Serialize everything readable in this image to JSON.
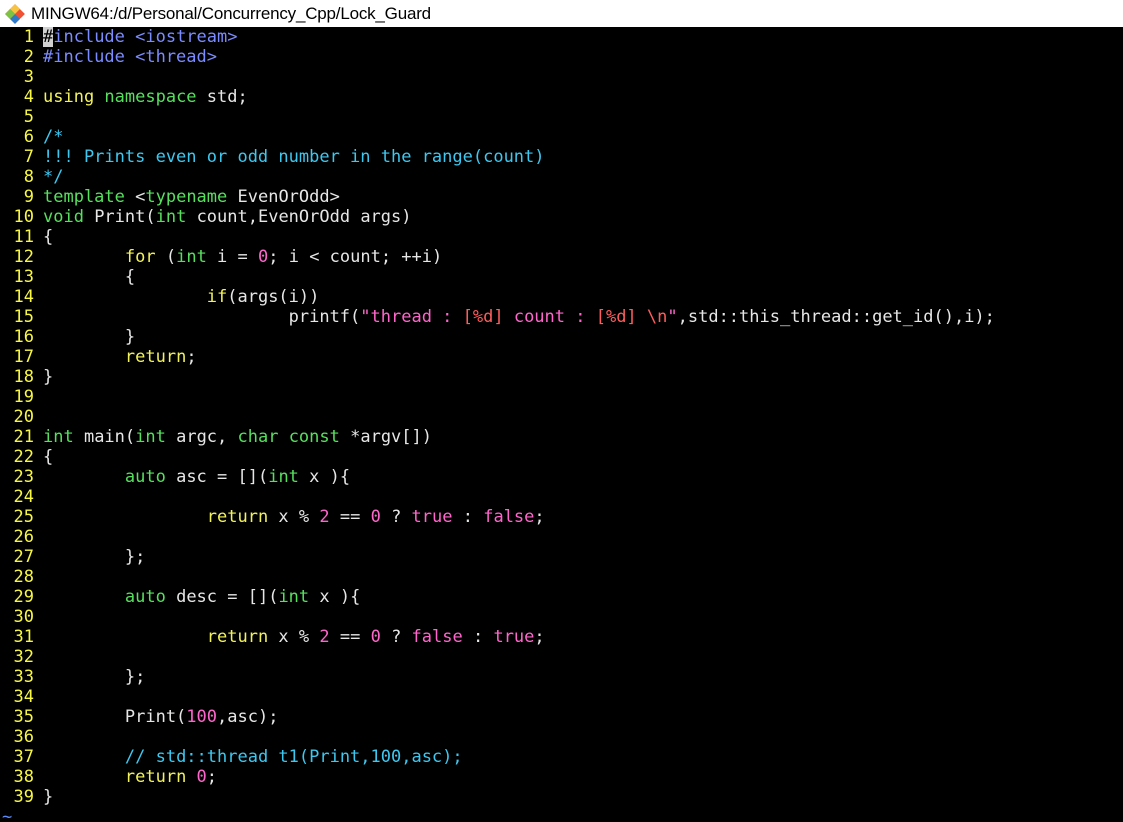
{
  "window": {
    "title": "MINGW64:/d/Personal/Concurrency_Cpp/Lock_Guard",
    "icon": "git-bash-icon"
  },
  "colors": {
    "background": "#000000",
    "line_number": "#f7f744",
    "keyword": "#f2f25c",
    "type": "#56e05e",
    "preprocessor": "#7a8cff",
    "string": "#ff66cc",
    "format_specifier": "#ff5d5d",
    "comment": "#3ec8f0",
    "empty_line_marker": "#5a8cff"
  },
  "editor": {
    "lines": [
      {
        "n": "1",
        "tokens": [
          [
            "pre",
            "#include <iostream>"
          ]
        ]
      },
      {
        "n": "2",
        "tokens": [
          [
            "pre",
            "#include <thread>"
          ]
        ]
      },
      {
        "n": "3",
        "tokens": []
      },
      {
        "n": "4",
        "tokens": [
          [
            "kw",
            "using "
          ],
          [
            "type",
            "namespace "
          ],
          [
            "plain",
            "std;"
          ]
        ]
      },
      {
        "n": "5",
        "tokens": []
      },
      {
        "n": "6",
        "tokens": [
          [
            "com",
            "/*"
          ]
        ]
      },
      {
        "n": "7",
        "tokens": [
          [
            "com",
            "!!! Prints even or odd number in the range(count)"
          ]
        ]
      },
      {
        "n": "8",
        "tokens": [
          [
            "com",
            "*/"
          ]
        ]
      },
      {
        "n": "9",
        "tokens": [
          [
            "type",
            "template "
          ],
          [
            "plain",
            "<"
          ],
          [
            "type",
            "typename "
          ],
          [
            "plain",
            "EvenOrOdd>"
          ]
        ]
      },
      {
        "n": "10",
        "tokens": [
          [
            "type",
            "void "
          ],
          [
            "plain",
            "Print("
          ],
          [
            "type",
            "int "
          ],
          [
            "plain",
            "count,EvenOrOdd args)"
          ]
        ]
      },
      {
        "n": "11",
        "tokens": [
          [
            "plain",
            "{"
          ]
        ]
      },
      {
        "n": "12",
        "tokens": [
          [
            "plain",
            "        "
          ],
          [
            "kw",
            "for "
          ],
          [
            "plain",
            "("
          ],
          [
            "type",
            "int "
          ],
          [
            "plain",
            "i = "
          ],
          [
            "num",
            "0"
          ],
          [
            "plain",
            "; i < count; ++i)"
          ]
        ]
      },
      {
        "n": "13",
        "tokens": [
          [
            "plain",
            "        {"
          ]
        ]
      },
      {
        "n": "14",
        "tokens": [
          [
            "plain",
            "                "
          ],
          [
            "kw",
            "if"
          ],
          [
            "plain",
            "(args(i))"
          ]
        ]
      },
      {
        "n": "15",
        "tokens": [
          [
            "plain",
            "                        printf("
          ],
          [
            "str",
            "\"thread : "
          ],
          [
            "fmt",
            "[%d]"
          ],
          [
            "str",
            " count : "
          ],
          [
            "fmt",
            "[%d] \\n"
          ],
          [
            "str",
            "\""
          ],
          [
            "plain",
            ",std::this_thread::get_id(),i);"
          ]
        ]
      },
      {
        "n": "16",
        "tokens": [
          [
            "plain",
            "        }"
          ]
        ]
      },
      {
        "n": "17",
        "tokens": [
          [
            "plain",
            "        "
          ],
          [
            "kw",
            "return"
          ],
          [
            "plain",
            ";"
          ]
        ]
      },
      {
        "n": "18",
        "tokens": [
          [
            "plain",
            "}"
          ]
        ]
      },
      {
        "n": "19",
        "tokens": []
      },
      {
        "n": "20",
        "tokens": []
      },
      {
        "n": "21",
        "tokens": [
          [
            "type",
            "int "
          ],
          [
            "plain",
            "main("
          ],
          [
            "type",
            "int "
          ],
          [
            "plain",
            "argc, "
          ],
          [
            "type",
            "char const "
          ],
          [
            "plain",
            "*argv[])"
          ]
        ]
      },
      {
        "n": "22",
        "tokens": [
          [
            "plain",
            "{"
          ]
        ]
      },
      {
        "n": "23",
        "tokens": [
          [
            "plain",
            "        "
          ],
          [
            "type",
            "auto "
          ],
          [
            "plain",
            "asc = []("
          ],
          [
            "type",
            "int "
          ],
          [
            "plain",
            "x ){"
          ]
        ]
      },
      {
        "n": "24",
        "tokens": []
      },
      {
        "n": "25",
        "tokens": [
          [
            "plain",
            "                "
          ],
          [
            "kw",
            "return "
          ],
          [
            "plain",
            "x % "
          ],
          [
            "num",
            "2"
          ],
          [
            "plain",
            " == "
          ],
          [
            "num",
            "0"
          ],
          [
            "plain",
            " ? "
          ],
          [
            "bool",
            "true"
          ],
          [
            "plain",
            " : "
          ],
          [
            "bool",
            "false"
          ],
          [
            "plain",
            ";"
          ]
        ]
      },
      {
        "n": "26",
        "tokens": []
      },
      {
        "n": "27",
        "tokens": [
          [
            "plain",
            "        };"
          ]
        ]
      },
      {
        "n": "28",
        "tokens": []
      },
      {
        "n": "29",
        "tokens": [
          [
            "plain",
            "        "
          ],
          [
            "type",
            "auto "
          ],
          [
            "plain",
            "desc = []("
          ],
          [
            "type",
            "int "
          ],
          [
            "plain",
            "x ){"
          ]
        ]
      },
      {
        "n": "30",
        "tokens": []
      },
      {
        "n": "31",
        "tokens": [
          [
            "plain",
            "                "
          ],
          [
            "kw",
            "return "
          ],
          [
            "plain",
            "x % "
          ],
          [
            "num",
            "2"
          ],
          [
            "plain",
            " == "
          ],
          [
            "num",
            "0"
          ],
          [
            "plain",
            " ? "
          ],
          [
            "bool",
            "false"
          ],
          [
            "plain",
            " : "
          ],
          [
            "bool",
            "true"
          ],
          [
            "plain",
            ";"
          ]
        ]
      },
      {
        "n": "32",
        "tokens": []
      },
      {
        "n": "33",
        "tokens": [
          [
            "plain",
            "        };"
          ]
        ]
      },
      {
        "n": "34",
        "tokens": []
      },
      {
        "n": "35",
        "tokens": [
          [
            "plain",
            "        Print("
          ],
          [
            "num",
            "100"
          ],
          [
            "plain",
            ",asc);"
          ]
        ]
      },
      {
        "n": "36",
        "tokens": []
      },
      {
        "n": "37",
        "tokens": [
          [
            "plain",
            "        "
          ],
          [
            "com",
            "// std::thread t1(Print,100,asc);"
          ]
        ]
      },
      {
        "n": "38",
        "tokens": [
          [
            "plain",
            "        "
          ],
          [
            "kw",
            "return "
          ],
          [
            "num",
            "0"
          ],
          [
            "plain",
            ";"
          ]
        ]
      },
      {
        "n": "39",
        "tokens": [
          [
            "plain",
            "}"
          ]
        ]
      }
    ],
    "empty_marker": "~"
  }
}
